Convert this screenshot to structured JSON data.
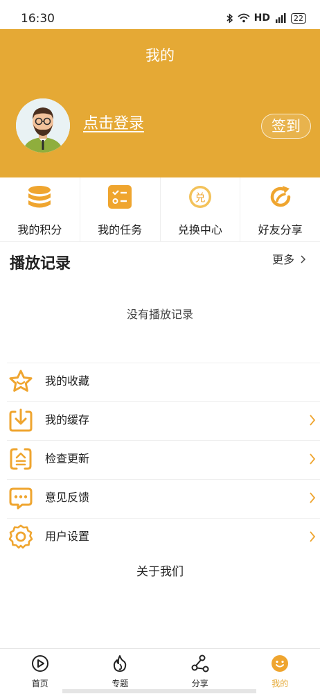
{
  "status": {
    "time": "16:30",
    "net": "HD",
    "battery": "22"
  },
  "header": {
    "title": "我的",
    "login_text": "点击登录",
    "signin_label": "签到"
  },
  "quick": [
    {
      "label": "我的积分",
      "icon": "coins-stack-icon"
    },
    {
      "label": "我的任务",
      "icon": "task-list-icon"
    },
    {
      "label": "兑换中心",
      "icon": "exchange-icon",
      "glyph": "兑"
    },
    {
      "label": "好友分享",
      "icon": "share-arrow-icon"
    }
  ],
  "history": {
    "title": "播放记录",
    "more": "更多",
    "empty": "没有播放记录"
  },
  "menu": [
    {
      "label": "我的收藏",
      "icon": "star-icon",
      "chevron": false
    },
    {
      "label": "我的缓存",
      "icon": "download-icon",
      "chevron": true
    },
    {
      "label": "检查更新",
      "icon": "update-icon",
      "chevron": true
    },
    {
      "label": "意见反馈",
      "icon": "feedback-icon",
      "chevron": true
    },
    {
      "label": "用户设置",
      "icon": "settings-gear-icon",
      "chevron": true
    }
  ],
  "about": "关于我们",
  "tabs": [
    {
      "label": "首页",
      "icon": "play-circle-icon"
    },
    {
      "label": "专题",
      "icon": "flame-icon"
    },
    {
      "label": "分享",
      "icon": "share-nodes-icon"
    },
    {
      "label": "我的",
      "icon": "smiley-icon",
      "active": true
    }
  ],
  "colors": {
    "accent": "#e5a935",
    "header_bg": "#e5a935"
  }
}
